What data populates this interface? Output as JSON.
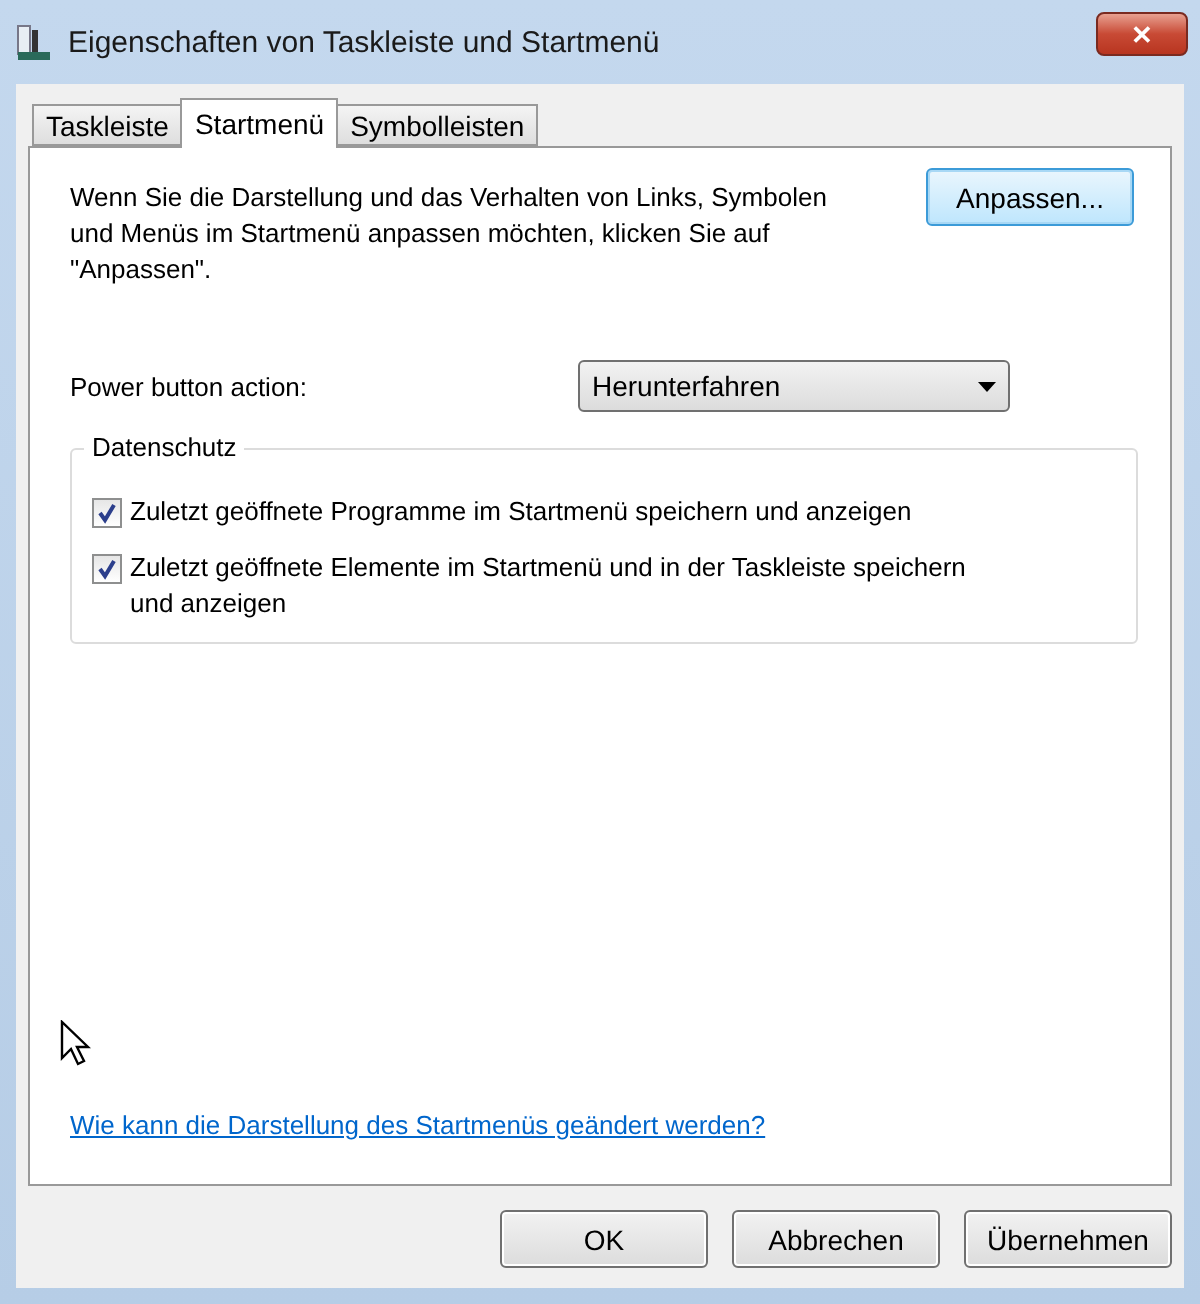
{
  "window": {
    "title": "Eigenschaften von Taskleiste und Startmenü",
    "close": "✕"
  },
  "tabs": [
    {
      "label": "Taskleiste",
      "selected": false
    },
    {
      "label": "Startmenü",
      "selected": true
    },
    {
      "label": "Symbolleisten",
      "selected": false
    }
  ],
  "description": "Wenn Sie die Darstellung und das Verhalten von Links, Symbolen und Menüs im Startmenü anpassen möchten, klicken Sie auf \"Anpassen\".",
  "customize_button": "Anpassen...",
  "power": {
    "label": "Power button action:",
    "value": "Herunterfahren"
  },
  "privacy": {
    "title": "Datenschutz",
    "options": [
      {
        "label": "Zuletzt geöffnete Programme im Startmenü speichern und anzeigen",
        "checked": true
      },
      {
        "label": "Zuletzt geöffnete Elemente im Startmenü und in der Taskleiste speichern und anzeigen",
        "checked": true
      }
    ]
  },
  "help_link": "Wie kann die Darstellung des Startmenüs geändert werden?",
  "buttons": [
    "OK",
    "Abbrechen",
    "Übernehmen"
  ]
}
